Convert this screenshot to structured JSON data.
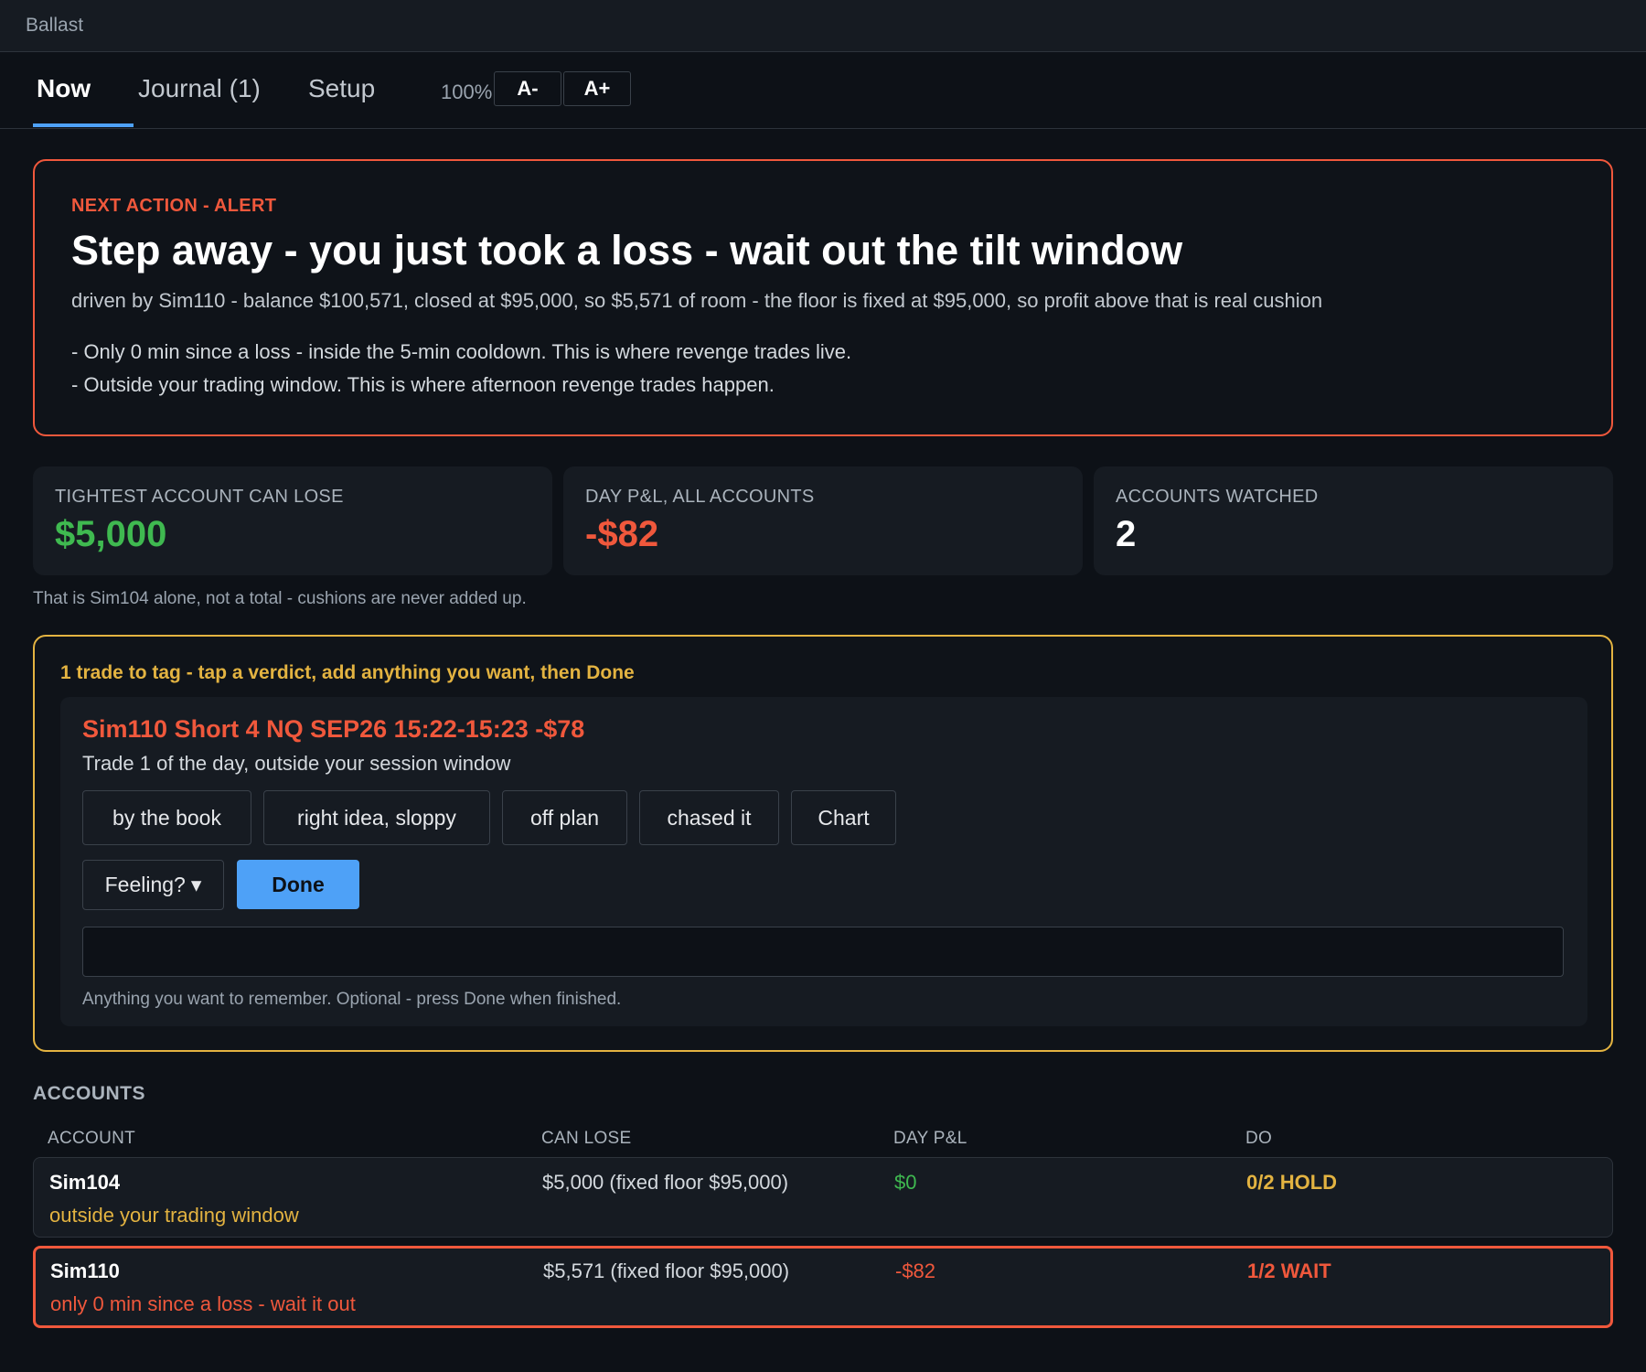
{
  "app": {
    "title": "Ballast"
  },
  "tabs": [
    {
      "label": "Now",
      "active": true
    },
    {
      "label": "Journal (1)",
      "active": false
    },
    {
      "label": "Setup",
      "active": false
    }
  ],
  "zoom": {
    "level": "100%",
    "decrease_label": "A-",
    "increase_label": "A+"
  },
  "alert": {
    "eyebrow": "NEXT ACTION - ALERT",
    "headline": "Step away - you just took a loss - wait out the tilt window",
    "subline": "driven by Sim110 - balance $100,571, closed at $95,000, so $5,571 of room - the floor is fixed at $95,000, so profit above that is real cushion",
    "bullets": [
      "- Only 0 min since a loss - inside the 5-min cooldown. This is where revenge trades live.",
      "- Outside your trading window. This is where afternoon revenge trades happen."
    ]
  },
  "stats": [
    {
      "label": "TIGHTEST ACCOUNT CAN LOSE",
      "value": "$5,000",
      "color": "#3fb950"
    },
    {
      "label": "DAY P&L, ALL ACCOUNTS",
      "value": "-$82",
      "color": "#f0583c"
    },
    {
      "label": "ACCOUNTS WATCHED",
      "value": "2",
      "color": "#ffffff"
    }
  ],
  "stats_footnote": "That is Sim104 alone, not a total - cushions are never added up.",
  "tagging": {
    "title": "1 trade to tag - tap a verdict, add anything you want, then Done",
    "trade": {
      "title": "Sim110 Short 4 NQ SEP26 15:22-15:23 -$78",
      "subtitle": "Trade 1 of the day, outside your session window"
    },
    "verdicts": [
      "by the book",
      "right idea, sloppy",
      "off plan",
      "chased it",
      "Chart"
    ],
    "feeling_label": "Feeling?",
    "feeling_arrow": "▾",
    "done_label": "Done",
    "note_value": "",
    "note_hint": "Anything you want to remember. Optional - press Done when finished."
  },
  "accounts": {
    "heading": "ACCOUNTS",
    "columns": [
      "ACCOUNT",
      "CAN LOSE",
      "DAY P&L",
      "DO"
    ],
    "rows": [
      {
        "name": "Sim104",
        "note": "outside your trading window",
        "can_lose": "$5,000 (fixed floor $95,000)",
        "day_pnl": "$0",
        "action": "0/2 HOLD",
        "status": "hold"
      },
      {
        "name": "Sim110",
        "note": "only 0 min since a loss - wait it out",
        "can_lose": "$5,571 (fixed floor $95,000)",
        "day_pnl": "-$82",
        "action": "1/2 WAIT",
        "status": "wait"
      }
    ]
  },
  "colors": {
    "accent": "#4ea1f7",
    "alert": "#f0583c",
    "warning": "#e3b341",
    "positive": "#3fb950",
    "background": "#0d1117",
    "panel": "#161b22"
  }
}
